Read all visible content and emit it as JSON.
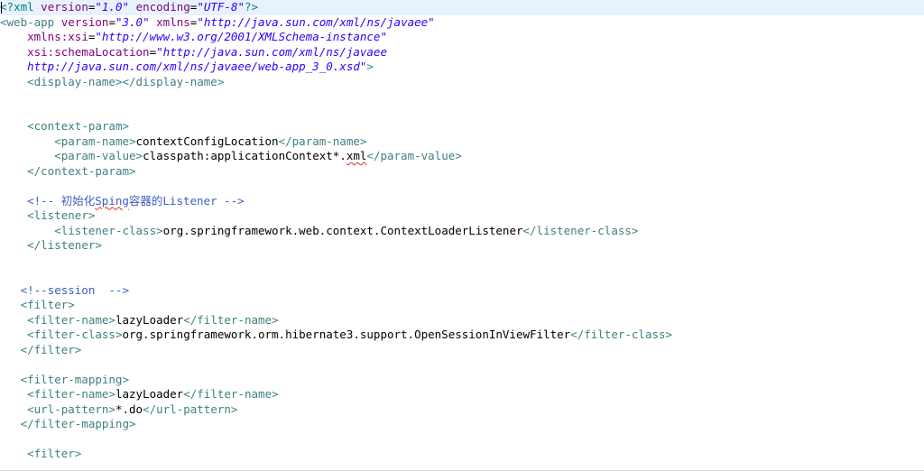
{
  "editor": {
    "lines": [
      [
        {
          "t": "<?",
          "c": "pi"
        },
        {
          "t": "xml ",
          "c": "pi"
        },
        {
          "t": "version",
          "c": "attr"
        },
        {
          "t": "=",
          "c": "pun"
        },
        {
          "t": "\"1.0\"",
          "c": "str"
        },
        {
          "t": " ",
          "c": "pun"
        },
        {
          "t": "encoding",
          "c": "attr"
        },
        {
          "t": "=",
          "c": "pun"
        },
        {
          "t": "\"UTF-8\"",
          "c": "str"
        },
        {
          "t": "?>",
          "c": "pi"
        }
      ],
      [
        {
          "t": "<",
          "c": "tag"
        },
        {
          "t": "web-app",
          "c": "tag"
        },
        {
          "t": " ",
          "c": "pun"
        },
        {
          "t": "version",
          "c": "attr"
        },
        {
          "t": "=",
          "c": "pun"
        },
        {
          "t": "\"3.0\"",
          "c": "str"
        },
        {
          "t": " ",
          "c": "pun"
        },
        {
          "t": "xmlns",
          "c": "attr"
        },
        {
          "t": "=",
          "c": "pun"
        },
        {
          "t": "\"http://java.sun.com/xml/ns/javaee\"",
          "c": "str"
        }
      ],
      [
        {
          "t": "    ",
          "c": "pun"
        },
        {
          "t": "xmlns:xsi",
          "c": "attr"
        },
        {
          "t": "=",
          "c": "pun"
        },
        {
          "t": "\"http://www.w3.org/2001/XMLSchema-instance\"",
          "c": "str"
        }
      ],
      [
        {
          "t": "    ",
          "c": "pun"
        },
        {
          "t": "xsi:schemaLocation",
          "c": "attr"
        },
        {
          "t": "=",
          "c": "pun"
        },
        {
          "t": "\"http://java.sun.com/xml/ns/javaee",
          "c": "str"
        }
      ],
      [
        {
          "t": "    ",
          "c": "pun"
        },
        {
          "t": "http://java.sun.com/xml/ns/javaee/web-app_3_0.xsd\"",
          "c": "str"
        },
        {
          "t": ">",
          "c": "tag"
        }
      ],
      [
        {
          "t": "    ",
          "c": "pun"
        },
        {
          "t": "<display-name></display-name>",
          "c": "tag"
        }
      ],
      [],
      [],
      [
        {
          "t": "    ",
          "c": "pun"
        },
        {
          "t": "<context-param>",
          "c": "tag"
        }
      ],
      [
        {
          "t": "        ",
          "c": "pun"
        },
        {
          "t": "<param-name>",
          "c": "tag"
        },
        {
          "t": "contextConfigLocation",
          "c": "text"
        },
        {
          "t": "</param-name>",
          "c": "tag"
        }
      ],
      [
        {
          "t": "        ",
          "c": "pun"
        },
        {
          "t": "<param-value>",
          "c": "tag"
        },
        {
          "t": "classpath:applicationContext*.",
          "c": "text"
        },
        {
          "t": "xml",
          "c": "text",
          "sq": true
        },
        {
          "t": "</param-value>",
          "c": "tag"
        }
      ],
      [
        {
          "t": "    ",
          "c": "pun"
        },
        {
          "t": "</context-param>",
          "c": "tag"
        }
      ],
      [],
      [
        {
          "t": "    ",
          "c": "pun"
        },
        {
          "t": "<!-- 初始化",
          "c": "com"
        },
        {
          "t": "Sping",
          "c": "com",
          "sq": true
        },
        {
          "t": "容器的Listener -->",
          "c": "com"
        }
      ],
      [
        {
          "t": "    ",
          "c": "pun"
        },
        {
          "t": "<listener>",
          "c": "tag"
        }
      ],
      [
        {
          "t": "        ",
          "c": "pun"
        },
        {
          "t": "<listener-class>",
          "c": "tag"
        },
        {
          "t": "org.springframework.web.context.ContextLoaderListener",
          "c": "text"
        },
        {
          "t": "</listener-class>",
          "c": "tag"
        }
      ],
      [
        {
          "t": "    ",
          "c": "pun"
        },
        {
          "t": "</listener>",
          "c": "tag"
        }
      ],
      [],
      [],
      [
        {
          "t": "   ",
          "c": "pun"
        },
        {
          "t": "<!--session  -->",
          "c": "com"
        }
      ],
      [
        {
          "t": "   ",
          "c": "pun"
        },
        {
          "t": "<filter>",
          "c": "tag"
        }
      ],
      [
        {
          "t": "    ",
          "c": "pun"
        },
        {
          "t": "<filter-name>",
          "c": "tag"
        },
        {
          "t": "lazyLoader",
          "c": "text"
        },
        {
          "t": "</filter-name>",
          "c": "tag"
        }
      ],
      [
        {
          "t": "    ",
          "c": "pun"
        },
        {
          "t": "<filter-class>",
          "c": "tag"
        },
        {
          "t": "org.springframework.orm.hibernate3.support.OpenSessionInViewFilter",
          "c": "text"
        },
        {
          "t": "</filter-class>",
          "c": "tag"
        }
      ],
      [
        {
          "t": "   ",
          "c": "pun"
        },
        {
          "t": "</filter>",
          "c": "tag"
        }
      ],
      [],
      [
        {
          "t": "   ",
          "c": "pun"
        },
        {
          "t": "<filter-mapping>",
          "c": "tag"
        }
      ],
      [
        {
          "t": "    ",
          "c": "pun"
        },
        {
          "t": "<filter-name>",
          "c": "tag"
        },
        {
          "t": "lazyLoader",
          "c": "text"
        },
        {
          "t": "</filter-name>",
          "c": "tag"
        }
      ],
      [
        {
          "t": "    ",
          "c": "pun"
        },
        {
          "t": "<url-pattern>",
          "c": "tag"
        },
        {
          "t": "*.do",
          "c": "text"
        },
        {
          "t": "</url-pattern>",
          "c": "tag"
        }
      ],
      [
        {
          "t": "   ",
          "c": "pun"
        },
        {
          "t": "</filter-mapping>",
          "c": "tag"
        }
      ],
      [],
      [
        {
          "t": "    ",
          "c": "pun"
        },
        {
          "t": "<filter>",
          "c": "tag"
        }
      ]
    ]
  }
}
